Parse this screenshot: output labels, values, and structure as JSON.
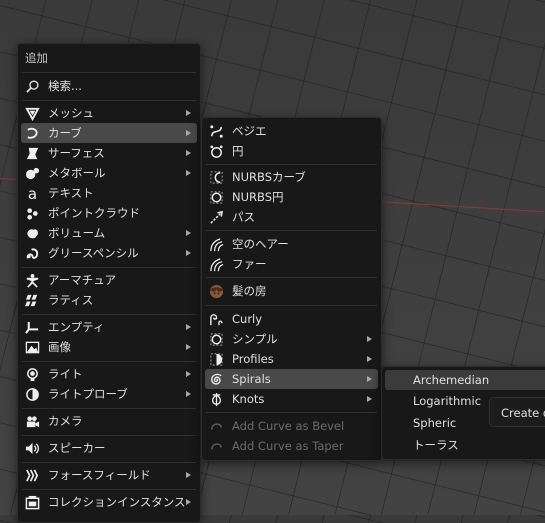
{
  "add_menu": {
    "title": "追加",
    "search_label": "検索...",
    "items": [
      {
        "label": "メッシュ",
        "icon": "mesh-icon"
      },
      {
        "label": "カーブ",
        "icon": "curve-icon"
      },
      {
        "label": "サーフェス",
        "icon": "surface-icon"
      },
      {
        "label": "メタボール",
        "icon": "metaball-icon"
      },
      {
        "label": "テキスト",
        "icon": "text-icon"
      },
      {
        "label": "ポイントクラウド",
        "icon": "pointcloud-icon"
      },
      {
        "label": "ボリューム",
        "icon": "volume-icon"
      },
      {
        "label": "グリースペンシル",
        "icon": "grease-pencil-icon"
      },
      {
        "label": "アーマチュア",
        "icon": "armature-icon"
      },
      {
        "label": "ラティス",
        "icon": "lattice-icon"
      },
      {
        "label": "エンプティ",
        "icon": "empty-icon"
      },
      {
        "label": "画像",
        "icon": "image-icon"
      },
      {
        "label": "ライト",
        "icon": "light-icon"
      },
      {
        "label": "ライトプローブ",
        "icon": "light-probe-icon"
      },
      {
        "label": "カメラ",
        "icon": "camera-icon"
      },
      {
        "label": "スピーカー",
        "icon": "speaker-icon"
      },
      {
        "label": "フォースフィールド",
        "icon": "force-field-icon"
      },
      {
        "label": "コレクションインスタンス",
        "icon": "collection-instance-icon"
      }
    ]
  },
  "curve_menu": {
    "items": [
      {
        "label": "ベジエ",
        "icon": "bezier-icon"
      },
      {
        "label": "円",
        "icon": "bezier-circle-icon"
      },
      {
        "label": "NURBSカーブ",
        "icon": "nurbs-curve-icon"
      },
      {
        "label": "NURBS円",
        "icon": "nurbs-circle-icon"
      },
      {
        "label": "パス",
        "icon": "path-icon"
      },
      {
        "label": "空のヘアー",
        "icon": "empty-hair-icon"
      },
      {
        "label": "ファー",
        "icon": "fur-icon"
      },
      {
        "label": "髪の房",
        "icon": "hair-tuft-icon"
      },
      {
        "label": "Curly",
        "icon": "curly-icon"
      },
      {
        "label": "シンプル",
        "icon": "simple-icon"
      },
      {
        "label": "Profiles",
        "icon": "profiles-icon"
      },
      {
        "label": "Spirals",
        "icon": "spirals-icon"
      },
      {
        "label": "Knots",
        "icon": "knots-icon"
      },
      {
        "label": "Add Curve as Bevel",
        "icon": "bevel-icon"
      },
      {
        "label": "Add Curve as Taper",
        "icon": "taper-icon"
      }
    ]
  },
  "spirals_menu": {
    "items": [
      {
        "label": "Archemedian"
      },
      {
        "label": "Logarithmic"
      },
      {
        "label": "Spheric"
      },
      {
        "label": "トーラス"
      }
    ]
  },
  "tooltip": {
    "text": "Create d"
  }
}
